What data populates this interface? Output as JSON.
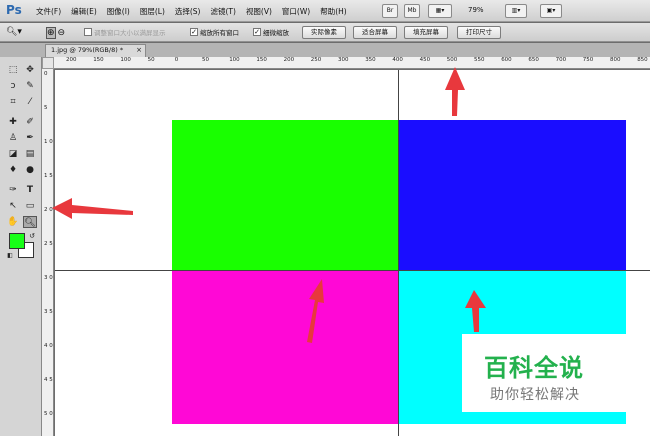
{
  "app": {
    "logo": "Ps"
  },
  "menu": [
    "文件(F)",
    "编辑(E)",
    "图像(I)",
    "图层(L)",
    "选择(S)",
    "滤镜(T)",
    "视图(V)",
    "窗口(W)",
    "帮助(H)"
  ],
  "toolbar": {
    "br_label": "Br",
    "mb_label": "Mb",
    "zoom": "79%"
  },
  "options": {
    "resize_windows": "调整窗口大小以满屏显示",
    "zoom_all": "缩放所有窗口",
    "scrubby_zoom": "细微缩放",
    "actual_pixels": "实际像素",
    "fit_screen": "适合屏幕",
    "fill_screen": "填充屏幕",
    "print_size": "打印尺寸"
  },
  "document": {
    "tab_title": "1.jpg @ 79%(RGB/8) *",
    "close_glyph": "×"
  },
  "rulers": {
    "top": [
      "200",
      "150",
      "100",
      "50",
      "0",
      "50",
      "100",
      "150",
      "200",
      "250",
      "300",
      "350",
      "400",
      "450",
      "500",
      "550",
      "600",
      "650",
      "700",
      "750",
      "800",
      "850"
    ],
    "left": [
      "0",
      "5",
      "1 0",
      "1 5",
      "2 0",
      "2 5",
      "3 0",
      "3 5",
      "4 0",
      "4 5",
      "5 0"
    ]
  },
  "canvas_colors": {
    "green": "#19ff00",
    "blue": "#1a0dff",
    "magenta": "#ff08d6",
    "cyan": "#00ffff",
    "arrow": "#e8383d"
  },
  "watermark": {
    "title": "百科全说",
    "subtitle": "助你轻松解决"
  }
}
